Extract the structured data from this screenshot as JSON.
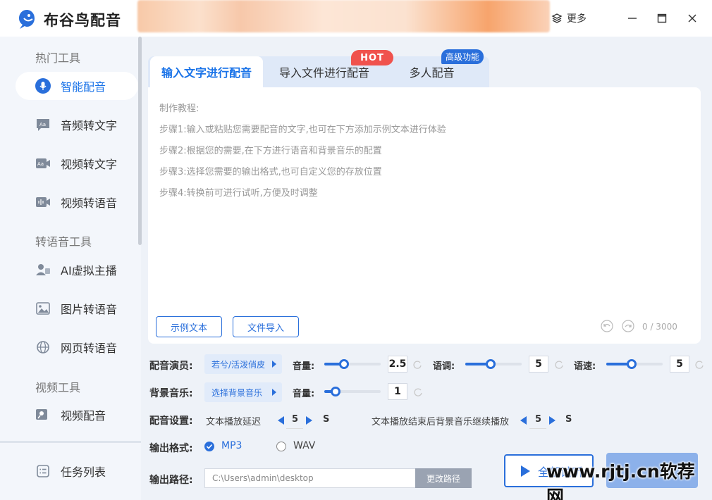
{
  "app": {
    "title": "布谷鸟配音",
    "more_label": "更多"
  },
  "sidebar": {
    "groups": [
      {
        "title": "热门工具"
      },
      {
        "title": "转语音工具"
      },
      {
        "title": "视频工具"
      }
    ],
    "items": [
      {
        "label": "智能配音",
        "icon": "mic-icon"
      },
      {
        "label": "音频转文字",
        "icon": "audio-text-icon"
      },
      {
        "label": "视频转文字",
        "icon": "video-text-icon"
      },
      {
        "label": "视频转语音",
        "icon": "video-voice-icon"
      },
      {
        "label": "AI虚拟主播",
        "icon": "avatar-icon"
      },
      {
        "label": "图片转语音",
        "icon": "image-icon"
      },
      {
        "label": "网页转语音",
        "icon": "globe-icon"
      },
      {
        "label": "视频配音",
        "icon": "video-mic-icon"
      }
    ],
    "task_list": {
      "label": "任务列表",
      "icon": "list-icon"
    }
  },
  "tabs": [
    {
      "label": "输入文字进行配音"
    },
    {
      "label": "导入文件进行配音"
    },
    {
      "label": "多人配音"
    }
  ],
  "badges": {
    "hot": "HOT",
    "advanced": "高级功能"
  },
  "editor": {
    "tutorial": [
      "制作教程:",
      "步骤1:输入或粘贴您需要配音的文字,也可在下方添加示例文本进行体验",
      "步骤2:根据您的需要,在下方进行语音和背景音乐的配置",
      "步骤3:选择您需要的输出格式,也可自定义您的存放位置",
      "步骤4:转换前可进行试听,方便及时调整"
    ],
    "sample_button": "示例文本",
    "import_button": "文件导入",
    "counter": "0 / 3000"
  },
  "voice": {
    "label": "配音演员:",
    "selected": "若兮/活泼俏皮",
    "volume_label": "音量:",
    "volume_value": "2.5",
    "volume_level": 0.35,
    "pitch_label": "语调:",
    "pitch_value": "5",
    "pitch_level": 0.45,
    "speed_label": "语速:",
    "speed_value": "5",
    "speed_level": 0.45
  },
  "bgm": {
    "label": "背景音乐:",
    "selected": "选择背景音乐",
    "volume_label": "音量:",
    "volume_value": "1",
    "volume_level": 0.2
  },
  "settings": {
    "label": "配音设置:",
    "delay_label": "文本播放延迟",
    "delay_value": "5",
    "delay_unit": "S",
    "continue_label": "文本播放结束后背景音乐继续播放",
    "continue_value": "5",
    "continue_unit": "S"
  },
  "format": {
    "label": "输出格式:",
    "options": [
      {
        "label": "MP3",
        "selected": true
      },
      {
        "label": "WAV",
        "selected": false
      }
    ]
  },
  "output": {
    "label": "输出路径:",
    "path": "C:\\Users\\admin\\desktop",
    "change_button": "更改路径"
  },
  "actions": {
    "play_label": "全部试听"
  },
  "watermark": "www.rjtj.cn软荐网",
  "colors": {
    "accent": "#2a6fdb",
    "hot": "#f0524d"
  }
}
